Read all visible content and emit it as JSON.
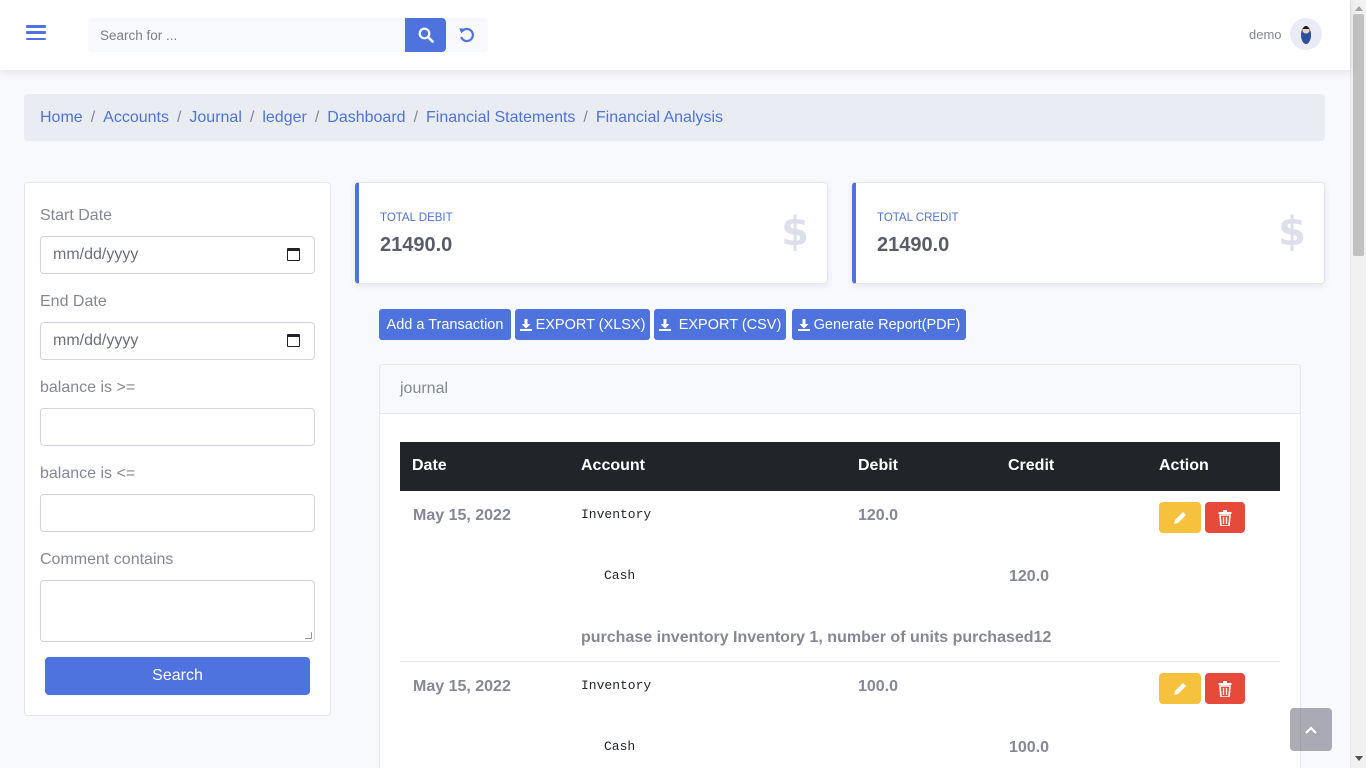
{
  "topbar": {
    "search_placeholder": "Search for ...",
    "user_name": "demo"
  },
  "breadcrumb": [
    "Home",
    "Accounts",
    "Journal",
    "ledger",
    "Dashboard",
    "Financial Statements",
    "Financial Analysis"
  ],
  "filters": {
    "start_date_label": "Start Date",
    "start_date_placeholder": "mm/dd/yyyy",
    "end_date_label": "End Date",
    "end_date_placeholder": "mm/dd/yyyy",
    "balance_gte_label": "balance is >=",
    "balance_lte_label": "balance is <=",
    "comment_label": "Comment contains",
    "search_button": "Search"
  },
  "stats": {
    "debit_label": "TOTAL DEBIT",
    "debit_value": "21490.0",
    "credit_label": "TOTAL CREDIT",
    "credit_value": "21490.0",
    "icon": "dollar-icon",
    "accent": "#4e73df"
  },
  "actions": {
    "add": "Add a Transaction",
    "export_xlsx": "EXPORT (XLSX)",
    "export_csv": "EXPORT (CSV)",
    "report_pdf": "Generate Report(PDF)"
  },
  "journal": {
    "title": "journal",
    "columns": [
      "Date",
      "Account",
      "Debit",
      "Credit",
      "Action"
    ],
    "entries": [
      {
        "date": "May 15, 2022",
        "debit_account": "Inventory",
        "debit": "120.0",
        "credit_account": "Cash",
        "credit": "120.0",
        "comment": "purchase inventory Inventory 1, number of units purchased12"
      },
      {
        "date": "May 15, 2022",
        "debit_account": "Inventory",
        "debit": "100.0",
        "credit_account": "Cash",
        "credit": "100.0"
      }
    ]
  },
  "colors": {
    "primary": "#4e73df",
    "warning": "#f6c23e",
    "danger": "#e74a3b",
    "table_header": "#212529"
  }
}
